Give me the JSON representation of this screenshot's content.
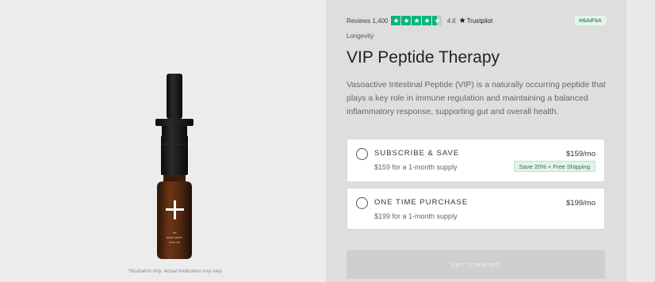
{
  "product_image": {
    "disclaimer": "*Illustration only. Actual medication may vary.",
    "label_lines": [
      "VIP",
      "NASAL SPRAY",
      "0.5 FL OZ"
    ]
  },
  "reviews": {
    "label": "Reviews 1,400",
    "stars_filled": 4.5,
    "rating": "4.6",
    "provider": "Trustpilot",
    "star_color": "#00b67a"
  },
  "badge": {
    "label": "HSA/FSA"
  },
  "product": {
    "category": "Longevity",
    "title": "VIP Peptide Therapy",
    "description": "Vasoactive Intestinal Peptide (VIP) is a naturally occurring peptide that plays a key role in immune regulation and maintaining a balanced inflammatory response, supporting gut and overall health."
  },
  "options": {
    "subscribe": {
      "name": "SUBSCRIBE & SAVE",
      "subtitle": "$159 for a 1-month supply",
      "price": "$159/mo",
      "badge": "Save 20% + Free Shipping"
    },
    "one_time": {
      "name": "ONE TIME PURCHASE",
      "subtitle": "$199 for a 1-month supply",
      "price": "$199/mo"
    }
  },
  "cta": {
    "label": "GET STARTED"
  }
}
